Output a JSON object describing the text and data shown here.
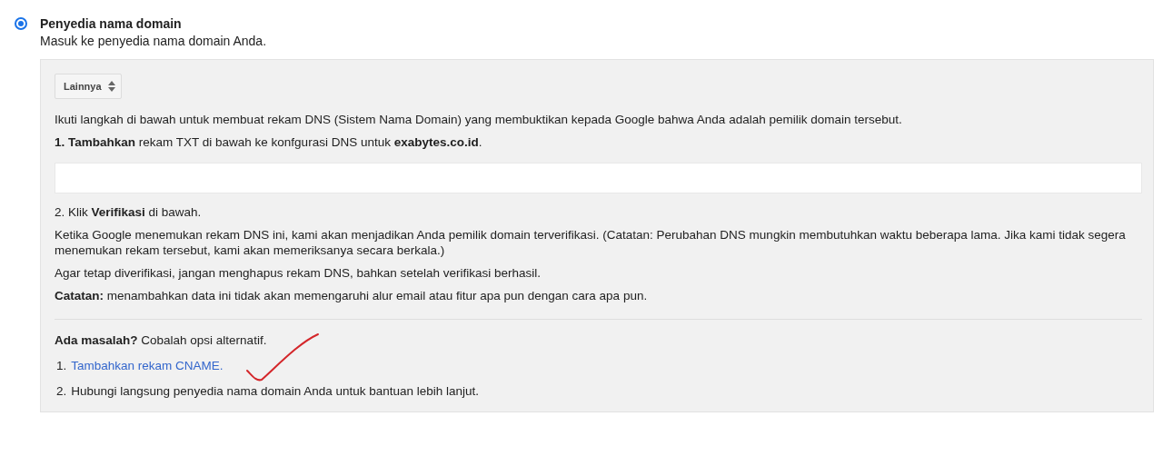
{
  "verification_option": {
    "selected": true,
    "title": "Penyedia nama domain",
    "subtitle": "Masuk ke penyedia nama domain Anda."
  },
  "panel": {
    "provider_select": {
      "value": "Lainnya"
    },
    "intro": "Ikuti langkah di bawah untuk membuat rekam DNS (Sistem Nama Domain) yang membuktikan kepada Google bahwa Anda adalah pemilik domain tersebut.",
    "step_1": "**1. Tambahkan** rekam TXT di bawah ke konfgurasi DNS untuk **exabytes.co.id**.",
    "step_2": "2. Klik **Verifikasi** di bawah.",
    "notes": [
      "Ketika Google menemukan rekam DNS ini, kami akan menjadikan Anda pemilik domain terverifikasi. (Catatan: Perubahan DNS mungkin membutuhkan waktu beberapa lama. Jika kami tidak segera menemukan rekam tersebut, kami akan memeriksanya secara berkala.)",
      "Agar tetap diverifikasi, jangan menghapus rekam DNS, bahkan setelah verifikasi berhasil.",
      "**Catatan:** menambahkan data ini tidak akan memengaruhi alur email atau fitur apa pun dengan cara apa pun."
    ],
    "troubleshoot_heading": "**Ada masalah?** Cobalah opsi alternatif.",
    "alternatives": [
      {
        "kind": "link",
        "number": "1.",
        "text": "Tambahkan rekam CNAME."
      },
      {
        "kind": "text",
        "number": "2.",
        "text": "Hubungi langsung penyedia nama domain Anda untuk bantuan lebih lanjut."
      }
    ]
  }
}
